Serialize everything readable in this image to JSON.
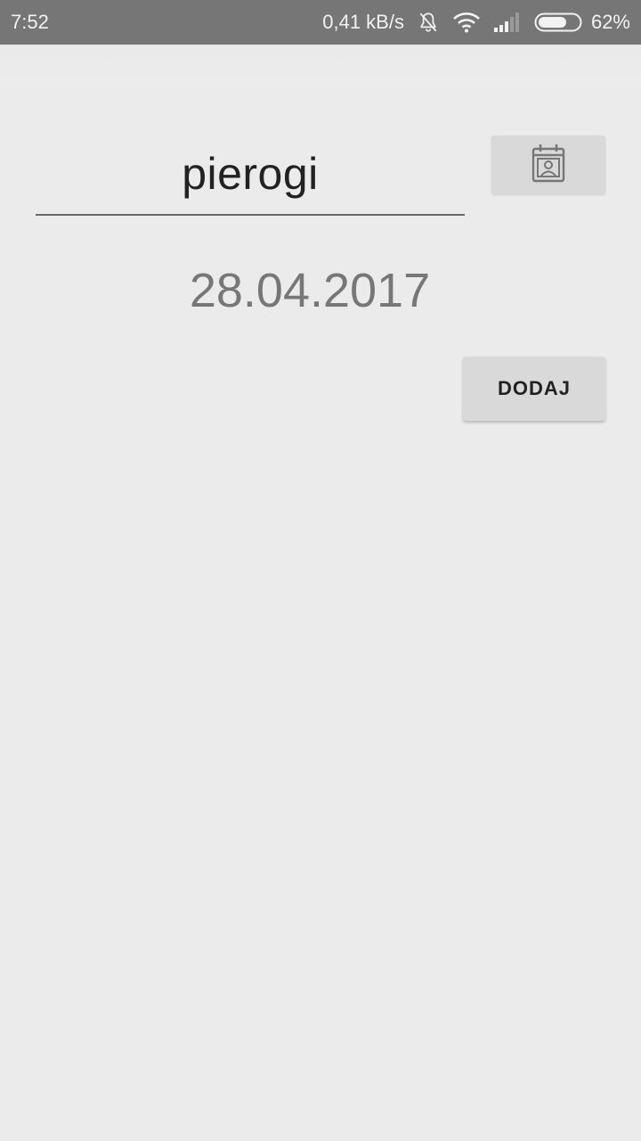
{
  "status_bar": {
    "time": "7:52",
    "network_speed": "0,41 kB/s",
    "battery": "62%",
    "battery_level": 0.62,
    "icons": [
      "bell-off-icon",
      "wifi-icon",
      "signal-icon",
      "battery-icon"
    ]
  },
  "form": {
    "name_value": "pierogi",
    "date_value": "28.04.2017",
    "calendar_button_icon": "calendar-contact-icon",
    "add_button_label": "DODAJ"
  },
  "colors": {
    "status_bar_bg": "#767676",
    "background": "#ebebeb",
    "button_bg": "#d9d9d9"
  }
}
